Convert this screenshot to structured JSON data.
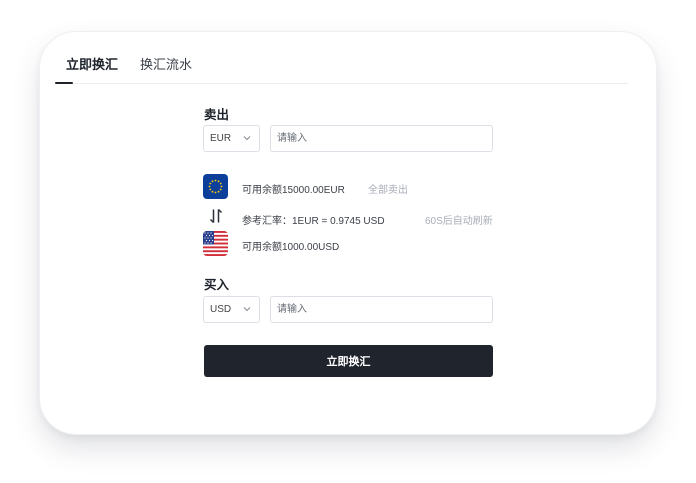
{
  "tabs": [
    {
      "label": "立即换汇",
      "active": true
    },
    {
      "label": "换汇流水",
      "active": false
    }
  ],
  "sell": {
    "label": "卖出",
    "currency": "EUR",
    "amount_placeholder": "请输入",
    "balance_text": "可用余额15000.00EUR",
    "sell_all_label": "全部卖出",
    "flag_icon": "eu-flag-icon"
  },
  "rate": {
    "text": "参考汇率：1EUR = 0.9745 USD",
    "refresh_text": "60S后自动刷新",
    "swap_icon": "swap-vertical-icon"
  },
  "buy": {
    "label": "买入",
    "currency": "USD",
    "amount_placeholder": "请输入",
    "balance_text": "可用余额1000.00USD",
    "flag_icon": "us-flag-icon"
  },
  "submit_label": "立即换汇",
  "colors": {
    "primary_button": "#1f242d",
    "muted_text": "#a8adb8",
    "eu_blue": "#0b3f9a",
    "eu_star": "#ffcc00",
    "us_red": "#d22f3a",
    "us_blue": "#2b3f8f"
  }
}
